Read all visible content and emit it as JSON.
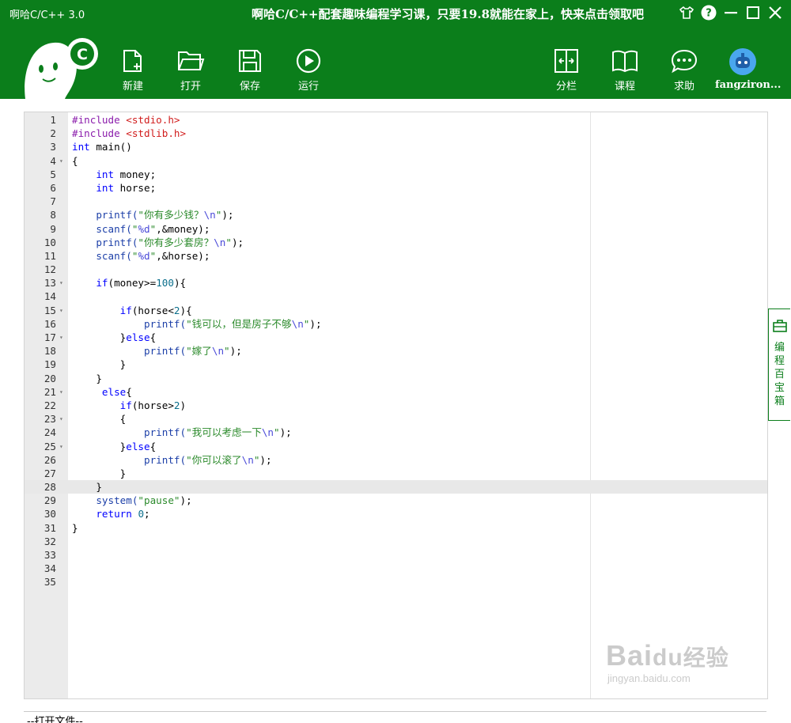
{
  "window": {
    "title": "啊哈C/C++ 3.0",
    "promo": "啊哈C/C++配套趣味编程学习课，只要19.8就能在家上，快来点击领取吧"
  },
  "toolbar": {
    "new_label": "新建",
    "open_label": "打开",
    "save_label": "保存",
    "run_label": "运行",
    "split_label": "分栏",
    "course_label": "课程",
    "help_label": "求助",
    "user_name": "fangziron..."
  },
  "sidepanel": {
    "label": "编程百宝箱"
  },
  "editor": {
    "active_line": 28,
    "lines": [
      {
        "n": "1"
      },
      {
        "n": "2"
      },
      {
        "n": "3"
      },
      {
        "n": "4"
      },
      {
        "n": "5"
      },
      {
        "n": "6"
      },
      {
        "n": "7"
      },
      {
        "n": "8"
      },
      {
        "n": "9"
      },
      {
        "n": "10"
      },
      {
        "n": "11"
      },
      {
        "n": "12"
      },
      {
        "n": "13"
      },
      {
        "n": "14"
      },
      {
        "n": "15"
      },
      {
        "n": "16"
      },
      {
        "n": "17"
      },
      {
        "n": "18"
      },
      {
        "n": "19"
      },
      {
        "n": "20"
      },
      {
        "n": "21"
      },
      {
        "n": "22"
      },
      {
        "n": "23"
      },
      {
        "n": "24"
      },
      {
        "n": "25"
      },
      {
        "n": "26"
      },
      {
        "n": "27"
      },
      {
        "n": "28"
      },
      {
        "n": "29"
      },
      {
        "n": "30"
      },
      {
        "n": "31"
      },
      {
        "n": "32"
      },
      {
        "n": "33"
      },
      {
        "n": "34"
      },
      {
        "n": "35"
      }
    ],
    "fold_lines": [
      "4",
      "13",
      "15",
      "17",
      "21",
      "23",
      "25"
    ],
    "code": {
      "l1_a": "#include",
      "l1_b": "<stdio.h>",
      "l2_a": "#include",
      "l2_b": "<stdlib.h>",
      "l3_a": "int",
      "l3_b": " main()",
      "l4": "{",
      "l5_a": "int",
      "l5_b": " money;",
      "l6_a": "int",
      "l6_b": " horse;",
      "l8_a": "printf(",
      "l8_b": "\"你有多少钱？",
      "l8_c": "\\n",
      "l8_d": "\"",
      "l8_e": ");",
      "l9_a": "scanf(",
      "l9_b": "\"",
      "l9_c": "%d",
      "l9_d": "\"",
      "l9_e": ",&money);",
      "l10_a": "printf(",
      "l10_b": "\"你有多少套房？",
      "l10_c": "\\n",
      "l10_d": "\"",
      "l10_e": ");",
      "l11_a": "scanf(",
      "l11_b": "\"",
      "l11_c": "%d",
      "l11_d": "\"",
      "l11_e": ",&horse);",
      "l13_a": "if",
      "l13_b": "(money>=",
      "l13_c": "100",
      "l13_d": "){",
      "l15_a": "if",
      "l15_b": "(horse<",
      "l15_c": "2",
      "l15_d": "){",
      "l16_a": "printf(",
      "l16_b": "\"钱可以，但是房子不够",
      "l16_c": "\\n",
      "l16_d": "\"",
      "l16_e": ");",
      "l17_a": "}",
      "l17_b": "else",
      "l17_c": "{",
      "l18_a": "printf(",
      "l18_b": "\"嫁了",
      "l18_c": "\\n",
      "l18_d": "\"",
      "l18_e": ");",
      "l19": "}",
      "l20": "}",
      "l21_a": "else",
      "l21_b": "{",
      "l22_a": "if",
      "l22_b": "(horse>",
      "l22_c": "2",
      "l22_d": ")",
      "l23": "{",
      "l24_a": "printf(",
      "l24_b": "\"我可以考虑一下",
      "l24_c": "\\n",
      "l24_d": "\"",
      "l24_e": ");",
      "l25_a": "}",
      "l25_b": "else",
      "l25_c": "{",
      "l26_a": "printf(",
      "l26_b": "\"你可以滚了",
      "l26_c": "\\n",
      "l26_d": "\"",
      "l26_e": ");",
      "l27": "}",
      "l28": "}",
      "l29_a": "system(",
      "l29_b": "\"pause\"",
      "l29_c": ");",
      "l30_a": "return",
      "l30_b": " ",
      "l30_c": "0",
      "l30_d": ";",
      "l31": "}"
    }
  },
  "output": {
    "label": "--打开文件--"
  },
  "watermark": {
    "brand": "Bai",
    "brand_mid": "du",
    "brand_cn": "经验",
    "url": "jingyan.baidu.com"
  },
  "colors": {
    "header": "#0b7e1b",
    "gutter": "#ebebeb",
    "active_line": "#e8e8e8"
  }
}
